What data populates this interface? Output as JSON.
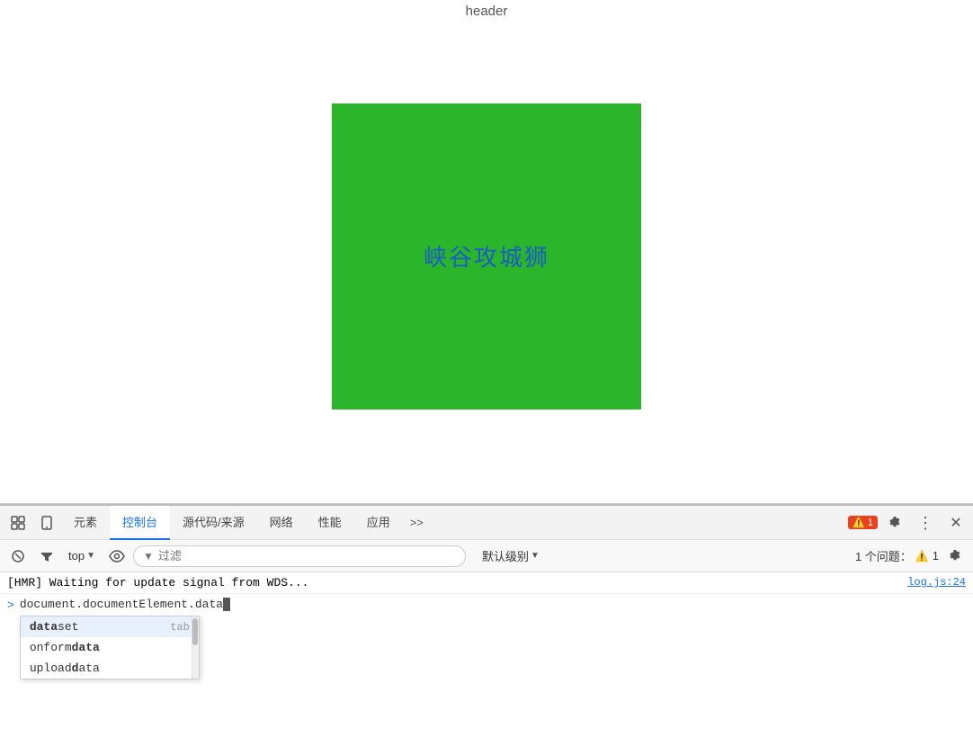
{
  "browser": {
    "page_title": "header"
  },
  "green_box": {
    "text": "峡谷攻城狮",
    "bg_color": "#2ab52a",
    "text_color": "#1a5cc8"
  },
  "devtools": {
    "tabs": [
      {
        "label": "元素",
        "active": false
      },
      {
        "label": "控制台",
        "active": true
      },
      {
        "label": "源代码/来源",
        "active": false
      },
      {
        "label": "网络",
        "active": false
      },
      {
        "label": "性能",
        "active": false
      },
      {
        "label": "应用",
        "active": false
      },
      {
        "label": ">>",
        "active": false
      }
    ],
    "error_badge": "1",
    "toolbar": {
      "top_label": "top",
      "filter_placeholder": "过滤",
      "default_level": "默认级别",
      "issues_label": "1 个问题：",
      "issues_count": "1"
    },
    "console_lines": [
      {
        "text": "[HMR] Waiting for update signal from WDS...",
        "source": "log.js:24"
      }
    ],
    "prompt": {
      "arrow": ">",
      "input_text": "document.documentElement.data"
    },
    "autocomplete": [
      {
        "text_pre": "",
        "text_bold": "data",
        "text_post": "set",
        "hint": "tab",
        "highlighted": true
      },
      {
        "text_pre": "onform",
        "text_bold": "data",
        "text_post": "",
        "hint": "",
        "highlighted": false
      },
      {
        "text_pre": "upload",
        "text_bold": "d",
        "text_post": "ata",
        "hint": "",
        "highlighted": false
      }
    ]
  }
}
